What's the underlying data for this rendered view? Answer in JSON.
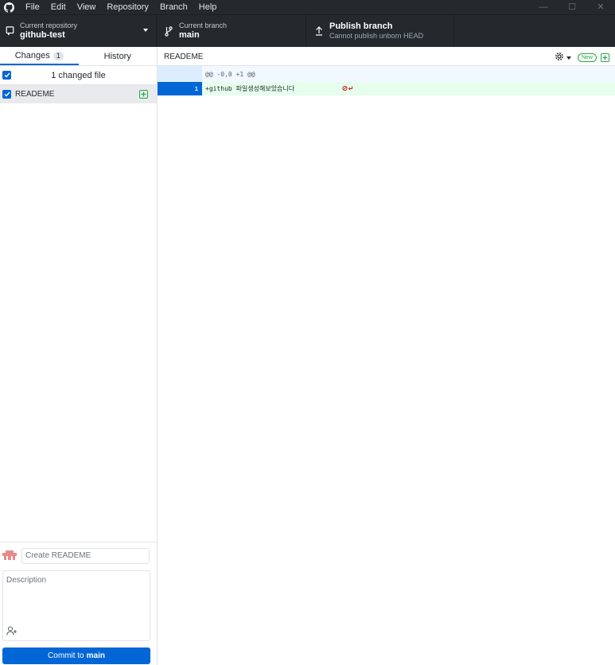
{
  "menu": {
    "items": [
      "File",
      "Edit",
      "View",
      "Repository",
      "Branch",
      "Help"
    ],
    "window_controls": [
      "—",
      "☐",
      "✕"
    ]
  },
  "toolbar": {
    "repo": {
      "label": "Current repository",
      "value": "github-test"
    },
    "branch": {
      "label": "Current branch",
      "value": "main"
    },
    "publish": {
      "title": "Publish branch",
      "subtitle": "Cannot publish unborn HEAD"
    }
  },
  "sidebar": {
    "tabs": [
      {
        "label": "Changes",
        "count": "1"
      },
      {
        "label": "History"
      }
    ],
    "changes_header": "1 changed file",
    "files": [
      {
        "name": "READEME"
      }
    ]
  },
  "commit": {
    "summary_placeholder": "Create READEME",
    "description_placeholder": "Description",
    "button_prefix": "Commit to",
    "button_branch": "main"
  },
  "diff": {
    "filename": "READEME",
    "new_badge": "New",
    "hunk_header": "@@ -0,0 +1 @@",
    "lines": [
      {
        "number": "1",
        "text": "+github 파일생성해보았습니다"
      }
    ]
  },
  "colors": {
    "accent": "#0366d6",
    "added": "#28a745",
    "dark_bar": "#24292e"
  }
}
